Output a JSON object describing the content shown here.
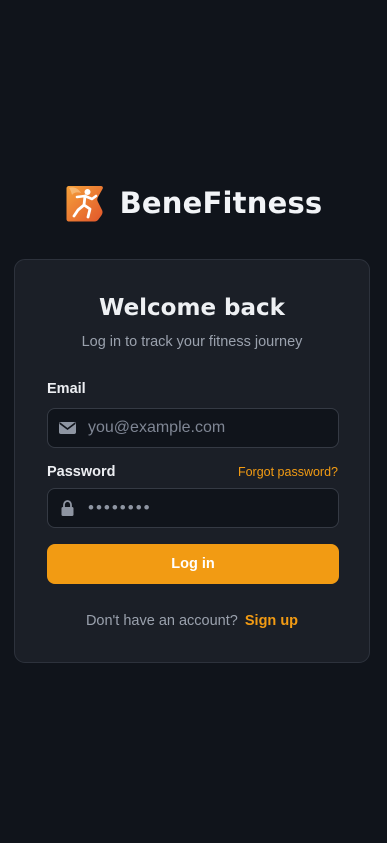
{
  "brand": {
    "name": "BeneFitness",
    "logo_icon": "runner-logo-icon",
    "accent": "#f29b13"
  },
  "login_card": {
    "title": "Welcome back",
    "subtitle": "Log in to track your fitness journey",
    "email": {
      "label": "Email",
      "placeholder": "you@example.com",
      "value": "",
      "icon": "envelope-icon"
    },
    "password": {
      "label": "Password",
      "forgot_link": "Forgot password?",
      "value": "••••••••",
      "icon": "lock-icon"
    },
    "submit_label": "Log in",
    "signup": {
      "prompt": "Don't have an account?",
      "link": "Sign up"
    }
  },
  "colors": {
    "background": "#10141b",
    "card": "#1b1f27",
    "accent": "#f29b13",
    "text_primary": "#eef0f3",
    "text_muted": "#9aa1ad"
  }
}
